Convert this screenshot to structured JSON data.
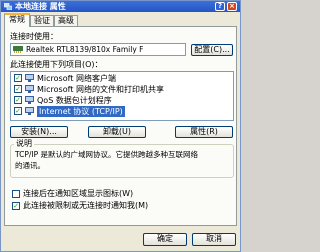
{
  "window": {
    "title": "本地连接 属性",
    "help_label": "?",
    "close_label": "×"
  },
  "tabs": [
    {
      "label": "常规"
    },
    {
      "label": "验证"
    },
    {
      "label": "高级"
    }
  ],
  "connect_using": {
    "label": "连接时使用：",
    "adapter": "Realtek RTL8139/810x Family F",
    "configure_label": "配置(C)..."
  },
  "components": {
    "label": "此连接使用下列项目(O)：",
    "items": [
      {
        "label": "Microsoft 网络客户端",
        "checked": true,
        "selected": false
      },
      {
        "label": "Microsoft 网络的文件和打印机共享",
        "checked": true,
        "selected": false
      },
      {
        "label": "QoS 数据包计划程序",
        "checked": true,
        "selected": false
      },
      {
        "label": "Internet 协议 (TCP/IP)",
        "checked": true,
        "selected": true
      }
    ]
  },
  "actions": {
    "install_label": "安装(N)...",
    "uninstall_label": "卸载(U)",
    "properties_label": "属性(R)"
  },
  "description": {
    "label": "说明",
    "text_line1": "TCP/IP 是默认的广域网协议。它提供跨越多种互联网络",
    "text_line2": "的通讯。"
  },
  "options": [
    {
      "label": "连接后在通知区域显示图标(W)",
      "checked": false
    },
    {
      "label": "此连接被限制或无连接时通知我(M)",
      "checked": true
    }
  ],
  "footer": {
    "ok_label": "确定",
    "cancel_label": "取消"
  }
}
